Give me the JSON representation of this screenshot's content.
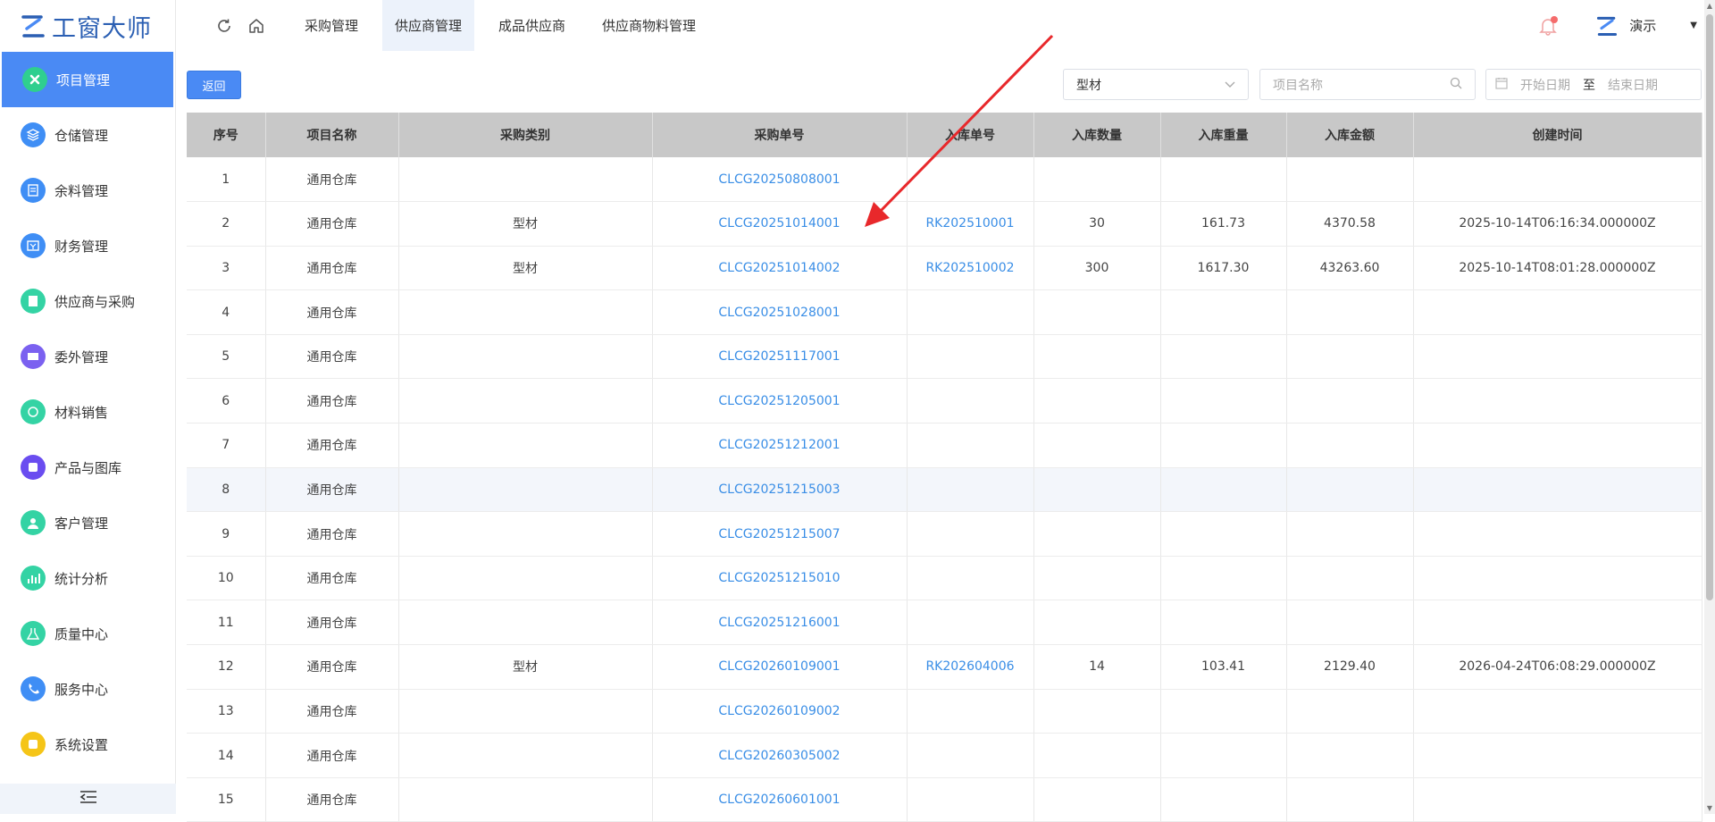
{
  "app": {
    "logo_text": "工窗大师"
  },
  "sidebar": {
    "items": [
      {
        "label": "项目管理",
        "icon": "project-icon",
        "color": "#2fcf8f",
        "active": true
      },
      {
        "label": "仓储管理",
        "icon": "layers-icon",
        "color": "#3f8ef5"
      },
      {
        "label": "余料管理",
        "icon": "clipboard-icon",
        "color": "#3f8ef5"
      },
      {
        "label": "财务管理",
        "icon": "finance-icon",
        "color": "#3f8ef5"
      },
      {
        "label": "供应商与采购",
        "icon": "supplier-icon",
        "color": "#34d3a4"
      },
      {
        "label": "委外管理",
        "icon": "outsource-icon",
        "color": "#7b61f0"
      },
      {
        "label": "材料销售",
        "icon": "sales-icon",
        "color": "#34d3a4"
      },
      {
        "label": "产品与图库",
        "icon": "product-icon",
        "color": "#6a4df0"
      },
      {
        "label": "客户管理",
        "icon": "customer-icon",
        "color": "#34d3a4"
      },
      {
        "label": "统计分析",
        "icon": "chart-icon",
        "color": "#34d3a4"
      },
      {
        "label": "质量中心",
        "icon": "quality-icon",
        "color": "#34d3a4"
      },
      {
        "label": "服务中心",
        "icon": "service-icon",
        "color": "#3f8ef5"
      },
      {
        "label": "系统设置",
        "icon": "settings-icon",
        "color": "#f5c518"
      }
    ]
  },
  "topbar": {
    "tabs": [
      "采购管理",
      "供应商管理",
      "成品供应商",
      "供应商物料管理"
    ],
    "active_tab": 1,
    "user": "演示"
  },
  "toolbar": {
    "back_label": "返回",
    "type_value": "型材",
    "name_placeholder": "项目名称",
    "start_placeholder": "开始日期",
    "date_sep": "至",
    "end_placeholder": "结束日期"
  },
  "table": {
    "headers": [
      "序号",
      "项目名称",
      "采购类别",
      "采购单号",
      "入库单号",
      "入库数量",
      "入库重量",
      "入库金额",
      "创建时间"
    ],
    "rows": [
      [
        "1",
        "通用仓库",
        "",
        "CLCG20250808001",
        "",
        "",
        "",
        "",
        ""
      ],
      [
        "2",
        "通用仓库",
        "型材",
        "CLCG20251014001",
        "RK202510001",
        "30",
        "161.73",
        "4370.58",
        "2025-10-14T06:16:34.000000Z"
      ],
      [
        "3",
        "通用仓库",
        "型材",
        "CLCG20251014002",
        "RK202510002",
        "300",
        "1617.30",
        "43263.60",
        "2025-10-14T08:01:28.000000Z"
      ],
      [
        "4",
        "通用仓库",
        "",
        "CLCG20251028001",
        "",
        "",
        "",
        "",
        ""
      ],
      [
        "5",
        "通用仓库",
        "",
        "CLCG20251117001",
        "",
        "",
        "",
        "",
        ""
      ],
      [
        "6",
        "通用仓库",
        "",
        "CLCG20251205001",
        "",
        "",
        "",
        "",
        ""
      ],
      [
        "7",
        "通用仓库",
        "",
        "CLCG20251212001",
        "",
        "",
        "",
        "",
        ""
      ],
      [
        "8",
        "通用仓库",
        "",
        "CLCG20251215003",
        "",
        "",
        "",
        "",
        ""
      ],
      [
        "9",
        "通用仓库",
        "",
        "CLCG20251215007",
        "",
        "",
        "",
        "",
        ""
      ],
      [
        "10",
        "通用仓库",
        "",
        "CLCG20251215010",
        "",
        "",
        "",
        "",
        ""
      ],
      [
        "11",
        "通用仓库",
        "",
        "CLCG20251216001",
        "",
        "",
        "",
        "",
        ""
      ],
      [
        "12",
        "通用仓库",
        "型材",
        "CLCG20260109001",
        "RK202604006",
        "14",
        "103.41",
        "2129.40",
        "2026-04-24T06:08:29.000000Z"
      ],
      [
        "13",
        "通用仓库",
        "",
        "CLCG20260109002",
        "",
        "",
        "",
        "",
        ""
      ],
      [
        "14",
        "通用仓库",
        "",
        "CLCG20260305002",
        "",
        "",
        "",
        "",
        ""
      ],
      [
        "15",
        "通用仓库",
        "",
        "CLCG20260601001",
        "",
        "",
        "",
        "",
        ""
      ]
    ],
    "hover_row": 7
  },
  "colors": {
    "accent": "#4a8af4",
    "link": "#3a8ee6",
    "header_bg": "#c8c8c8",
    "annotation_arrow": "#e8282b"
  }
}
